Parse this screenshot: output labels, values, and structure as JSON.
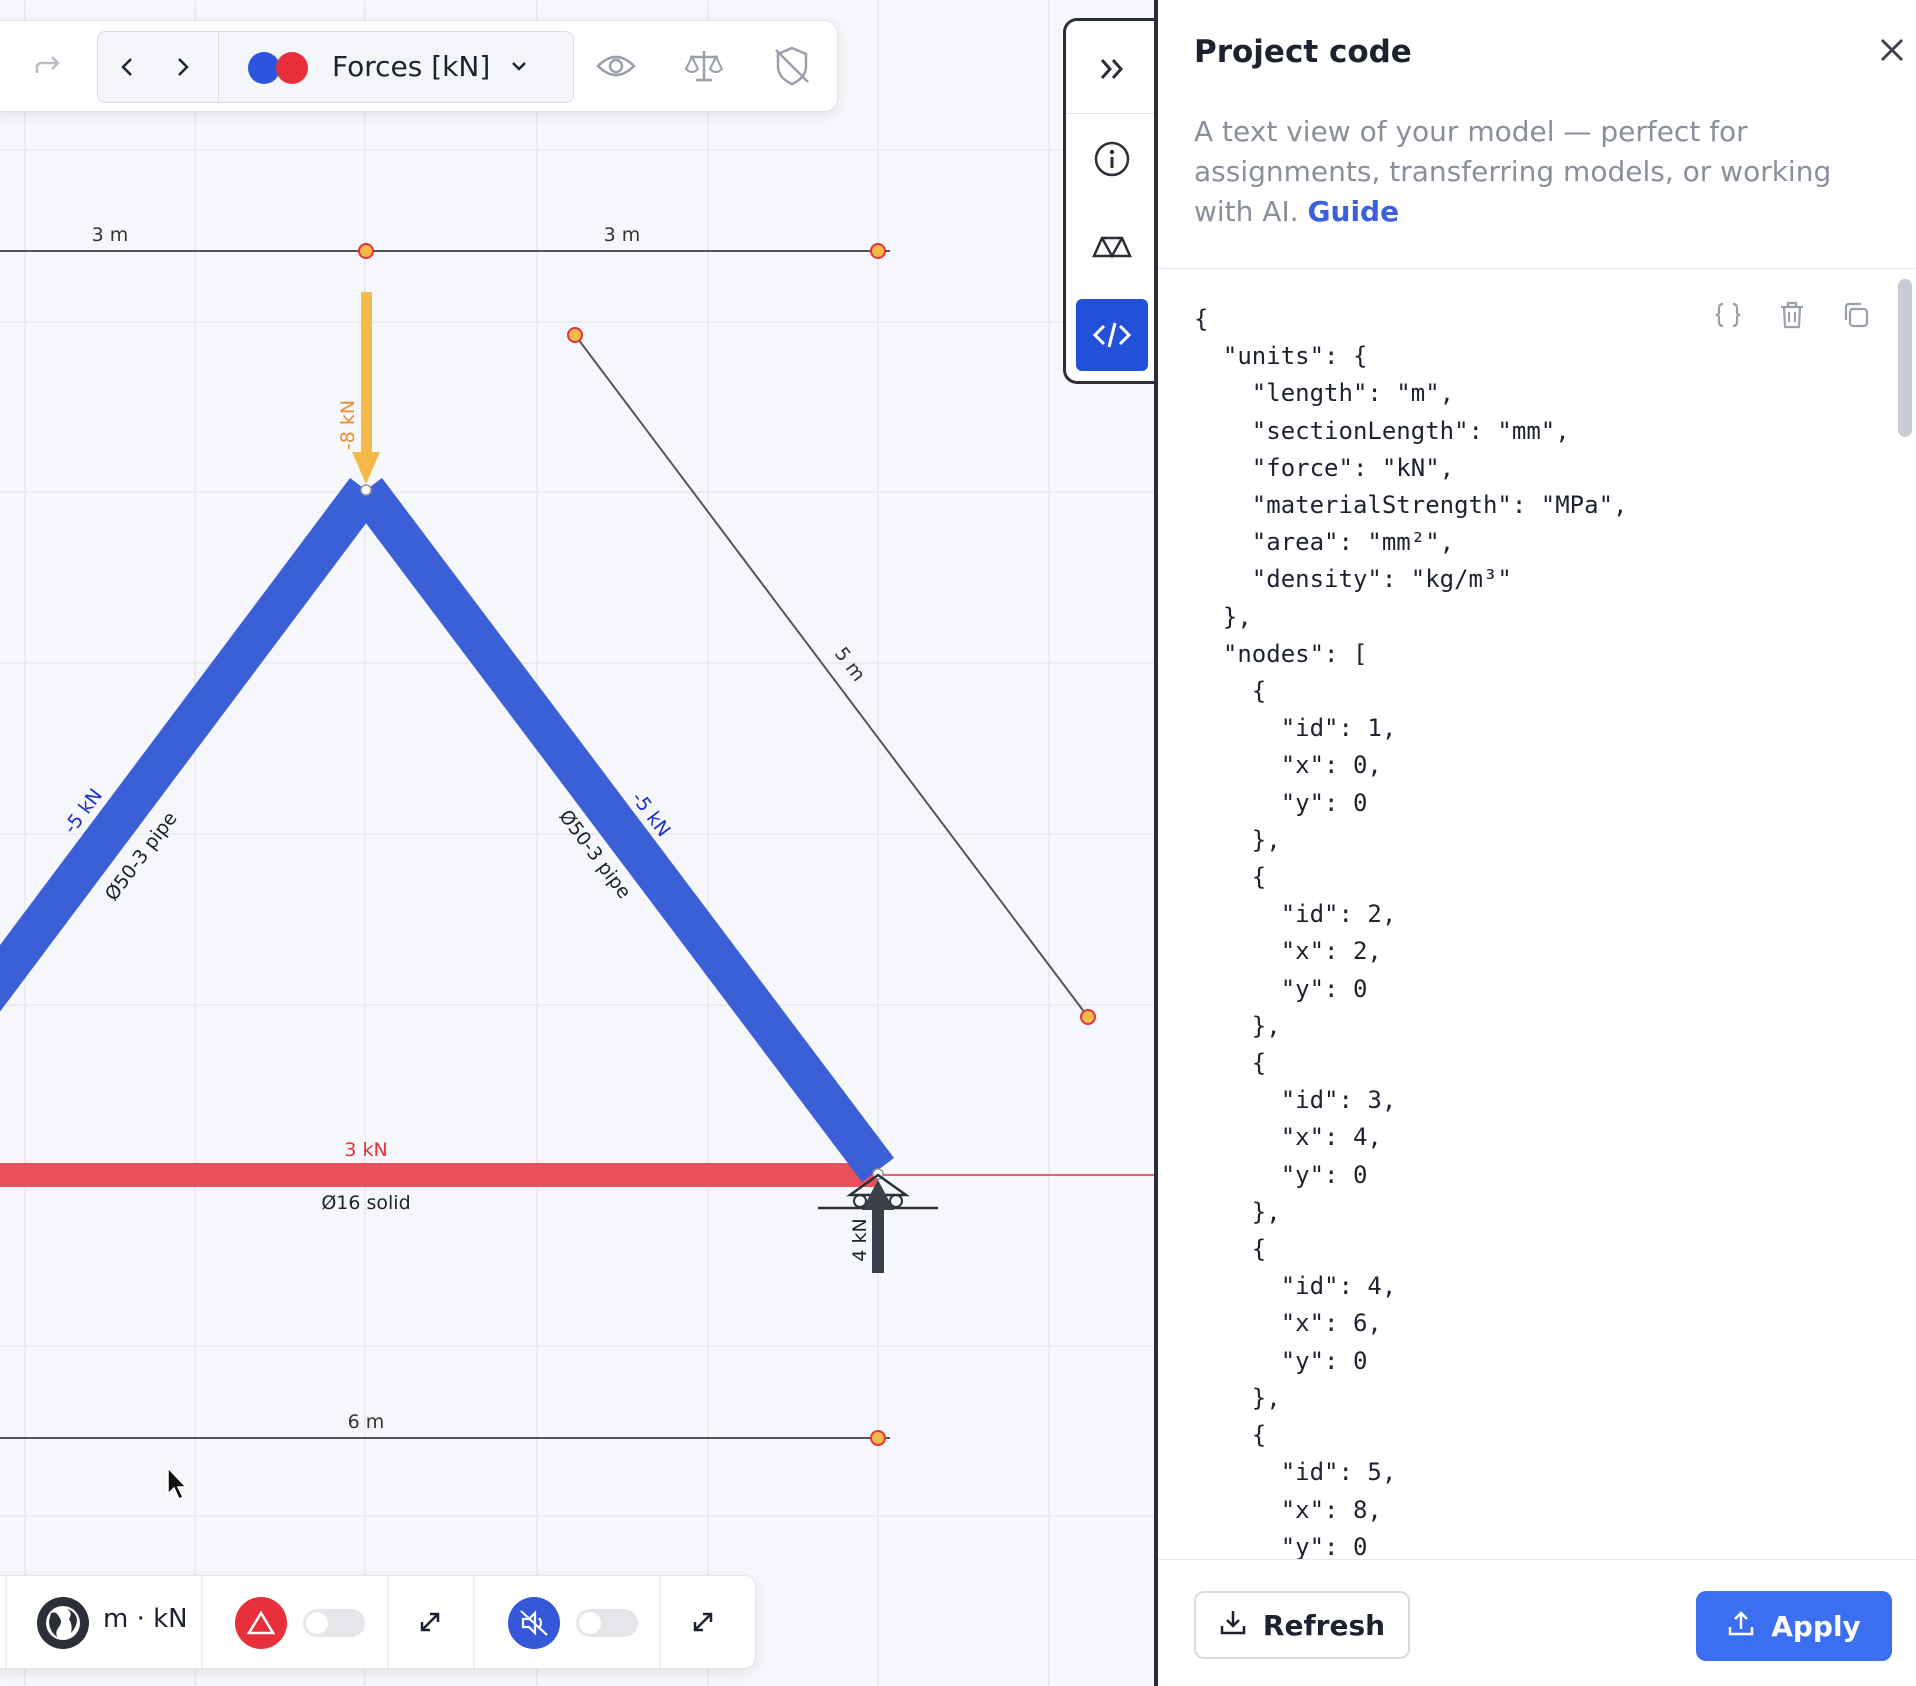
{
  "toolbar": {
    "redo_icon": "redo-icon",
    "result_type": "Forces [kN]",
    "result_colors": [
      "#2c55e0",
      "#e8303c"
    ],
    "view_icon": "eye-icon",
    "balance_icon": "scale-icon",
    "shield_icon": "shield-off-icon"
  },
  "side_rail": {
    "items": [
      "collapse-icon",
      "info-icon",
      "shape-icon",
      "code-icon"
    ],
    "active": "code-icon",
    "accent": "#2350d8"
  },
  "canvas": {
    "dimensions": {
      "top_left": "3 m",
      "top_right": "3 m",
      "diagonal": "5 m",
      "bottom": "6 m"
    },
    "load_label": "-8 kN",
    "reaction_label": "4 kN",
    "members": {
      "left": {
        "force": "-5 kN",
        "section": "Ø50-3 pipe"
      },
      "right": {
        "force": "-5 kN",
        "section": "Ø50-3 pipe"
      },
      "bottom": {
        "force": "3 kN",
        "section": "Ø16 solid"
      }
    },
    "colors": {
      "compression": "#3a5fd6",
      "tension": "#e8505c",
      "load": "#f5b94b"
    }
  },
  "bottom_bar": {
    "units": "m · kN",
    "globe_icon": "globe-icon",
    "warning_icon": "warning-icon",
    "mute_icon": "mute-icon"
  },
  "panel": {
    "title": "Project code",
    "description": "A text view of your model — perfect for assignments, transferring models, or working with AI.",
    "guide_link": "Guide",
    "code": "{\n  \"units\": {\n    \"length\": \"m\",\n    \"sectionLength\": \"mm\",\n    \"force\": \"kN\",\n    \"materialStrength\": \"MPa\",\n    \"area\": \"mm²\",\n    \"density\": \"kg/m³\"\n  },\n  \"nodes\": [\n    {\n      \"id\": 1,\n      \"x\": 0,\n      \"y\": 0\n    },\n    {\n      \"id\": 2,\n      \"x\": 2,\n      \"y\": 0\n    },\n    {\n      \"id\": 3,\n      \"x\": 4,\n      \"y\": 0\n    },\n    {\n      \"id\": 4,\n      \"x\": 6,\n      \"y\": 0\n    },\n    {\n      \"id\": 5,\n      \"x\": 8,\n      \"y\": 0",
    "format_icon": "braces-icon",
    "delete_icon": "trash-icon",
    "copy_icon": "copy-icon",
    "refresh_label": "Refresh",
    "apply_label": "Apply"
  }
}
